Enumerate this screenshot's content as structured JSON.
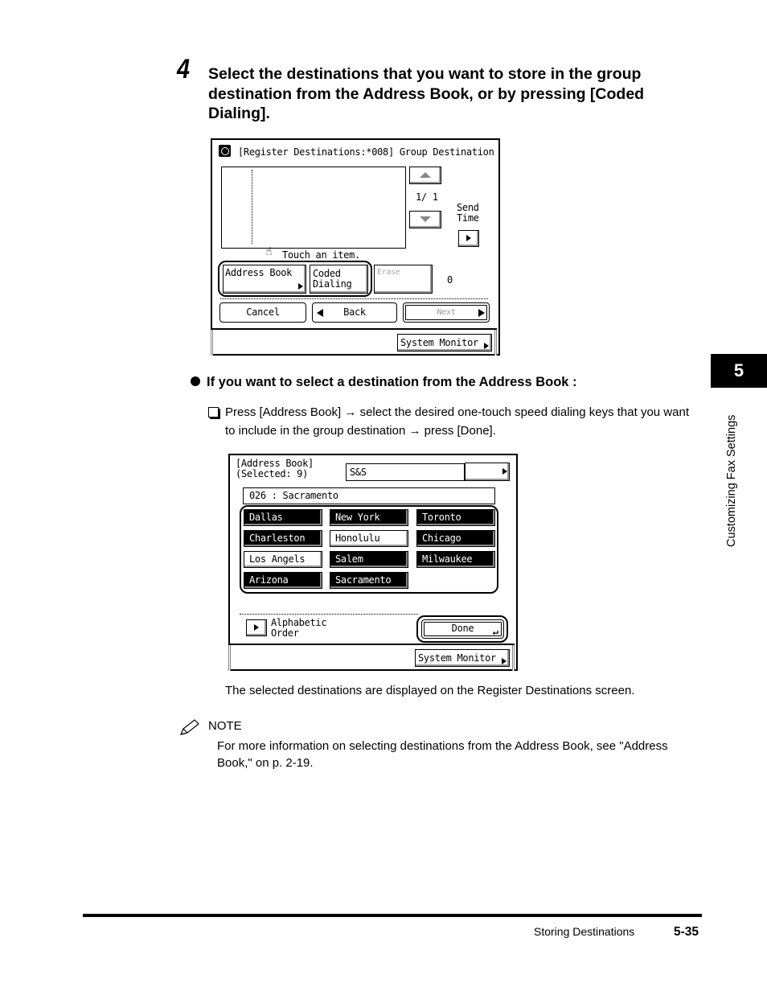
{
  "step": {
    "number": "4",
    "text": "Select the destinations that you want to store in the group destination from the Address Book, or by pressing [Coded Dialing]."
  },
  "screen1": {
    "title": "[Register Destinations:*008] Group Destination",
    "title_icon": "fax-icon",
    "page_indicator": "1/ 1",
    "send_time_label": [
      "Send",
      "Time"
    ],
    "hint": "Touch an item.",
    "buttons": {
      "address_book": "Address Book",
      "coded_dialing": [
        "Coded",
        "Dialing"
      ],
      "erase": "Erase",
      "count": "0",
      "cancel": "Cancel",
      "back": "Back",
      "next": "Next",
      "system_monitor": "System Monitor"
    }
  },
  "bullet": {
    "heading": "If you want to select a destination from the Address Book :",
    "instruction": "Press [Address Book] → select the desired one-touch speed dialing keys that you want to include in the group destination → press [Done]."
  },
  "screen2": {
    "title_line1": "[Address Book]",
    "title_line2": "(Selected: 9)",
    "search_value": "S&S",
    "current_entry": "026 : Sacramento",
    "destinations": [
      {
        "label": "Dallas",
        "selected": true
      },
      {
        "label": "New York",
        "selected": true
      },
      {
        "label": "Toronto",
        "selected": true
      },
      {
        "label": "Charleston",
        "selected": true
      },
      {
        "label": "Honolulu",
        "selected": false
      },
      {
        "label": "Chicago",
        "selected": true
      },
      {
        "label": "Los Angels",
        "selected": false
      },
      {
        "label": "Salem",
        "selected": true
      },
      {
        "label": "Milwaukee",
        "selected": true
      },
      {
        "label": "Arizona",
        "selected": true
      },
      {
        "label": "Sacramento",
        "selected": true
      }
    ],
    "alphabetic_order": [
      "Alphabetic",
      "Order"
    ],
    "done": "Done",
    "system_monitor": "System Monitor"
  },
  "result_text": "The selected destinations are displayed on the Register Destinations screen.",
  "note": {
    "label": "NOTE",
    "text": "For more information on selecting destinations from the Address Book, see \"Address Book,\" on p. 2-19."
  },
  "chapter": {
    "number": "5",
    "title": "Customizing Fax Settings"
  },
  "footer": {
    "section": "Storing Destinations",
    "page": "5-35"
  }
}
